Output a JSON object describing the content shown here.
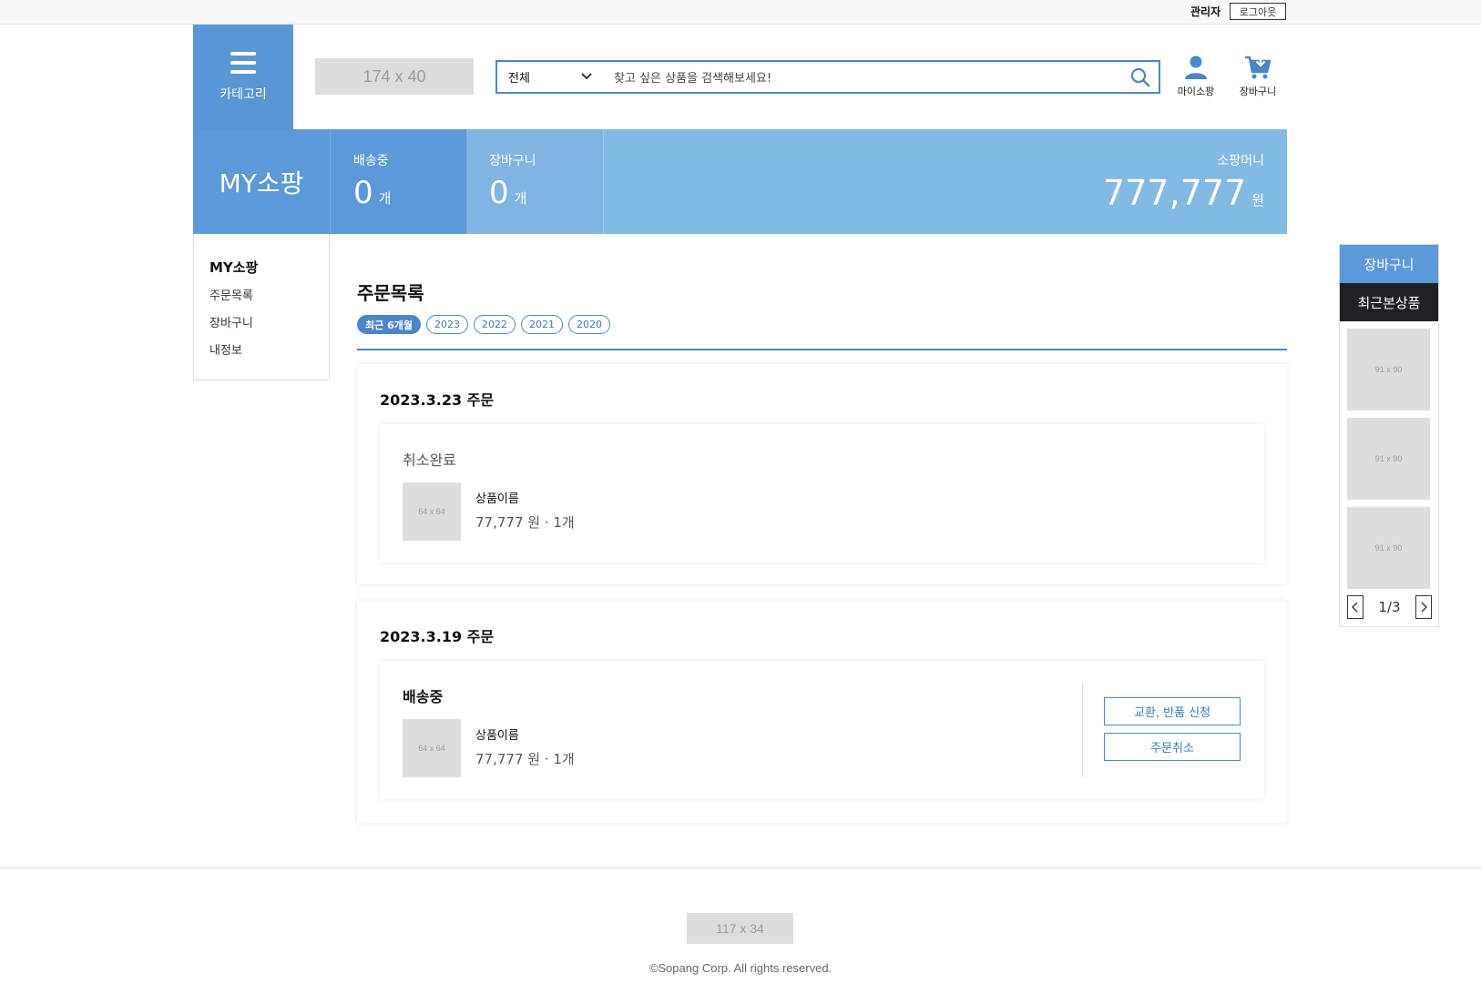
{
  "topbar": {
    "admin_label": "관리자",
    "logout_label": "로그아웃"
  },
  "header": {
    "category_label": "카테고리",
    "logo_placeholder": "174 x 40",
    "search": {
      "selected_option": "전체",
      "placeholder": "찾고 싶은 상품을 검색해보세요!"
    },
    "mypage_label": "마이소팡",
    "cart_label": "장바구니"
  },
  "summary": {
    "title": "MY소팡",
    "shipping": {
      "label": "배송중",
      "count": "0",
      "unit": "개"
    },
    "cart": {
      "label": "장바구니",
      "count": "0",
      "unit": "개"
    },
    "money": {
      "label": "소팡머니",
      "amount": "777,777",
      "unit": "원"
    }
  },
  "sidenav": {
    "heading": "MY소팡",
    "items": [
      "주문목록",
      "장바구니",
      "내정보"
    ]
  },
  "orders": {
    "title": "주문목록",
    "filters": [
      "최근 6개월",
      "2023",
      "2022",
      "2021",
      "2020"
    ],
    "list": [
      {
        "date": "2023.3.23 주문",
        "status": "취소완료",
        "thumb": "64 x 64",
        "product_name": "상품이름",
        "price_qty": "77,777 원 · 1개"
      },
      {
        "date": "2023.3.19 주문",
        "status": "배송중",
        "thumb": "64 x 64",
        "product_name": "상품이름",
        "price_qty": "77,777 원 · 1개",
        "actions": [
          "교환, 반품 신청",
          "주문취소"
        ]
      }
    ]
  },
  "right_sidebar": {
    "cart_label": "장바구니",
    "recent_label": "최근본상품",
    "thumbs": [
      "91 x 90",
      "91 x 90",
      "91 x 90"
    ],
    "page": "1/3"
  },
  "footer": {
    "logo_placeholder": "117 x 34",
    "copyright": "©Sopang Corp. All rights reserved."
  },
  "colors": {
    "accent": "#5b99d8",
    "accent_light": "#82bae4",
    "dark": "#1e2226",
    "placeholder": "#dddddd"
  }
}
